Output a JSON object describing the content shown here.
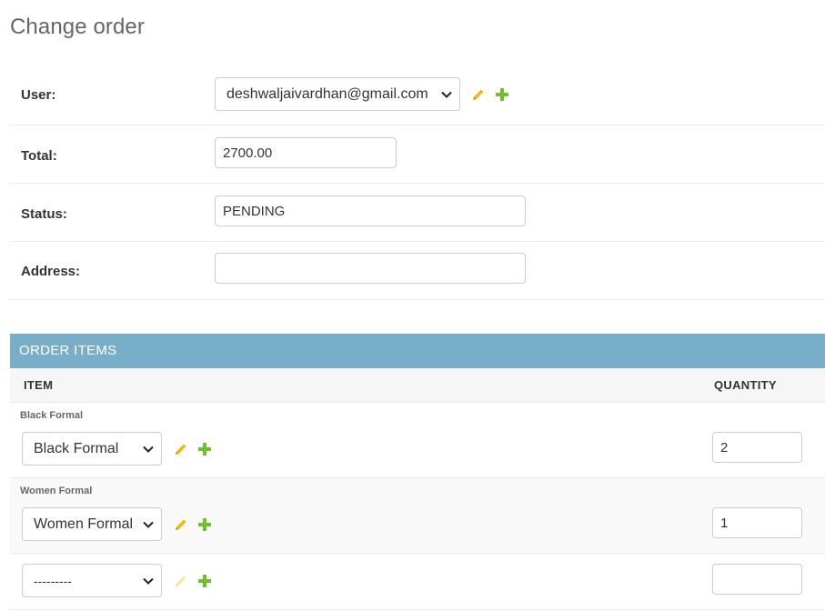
{
  "page": {
    "title": "Change order"
  },
  "form": {
    "user": {
      "label": "User:",
      "value": "deshwaljaivardhan@gmail.com"
    },
    "total": {
      "label": "Total:",
      "value": "2700.00"
    },
    "status": {
      "label": "Status:",
      "value": "PENDING"
    },
    "address": {
      "label": "Address:",
      "value": ""
    }
  },
  "inline": {
    "title": "ORDER ITEMS",
    "columns": {
      "item": "ITEM",
      "quantity": "QUANTITY"
    },
    "rows": [
      {
        "title": "Black Formal",
        "item": "Black Formal",
        "quantity": "2"
      },
      {
        "title": "Women Formal",
        "item": "Women Formal",
        "quantity": "1"
      },
      {
        "title": "",
        "item": "---------",
        "quantity": ""
      }
    ]
  },
  "colors": {
    "module_header": "#79aec8",
    "edit_icon": "#efb80b",
    "add_icon": "#70bf2b"
  },
  "icons": {
    "edit": "pencil-icon",
    "add": "plus-icon",
    "select": "chevron-down-icon"
  }
}
